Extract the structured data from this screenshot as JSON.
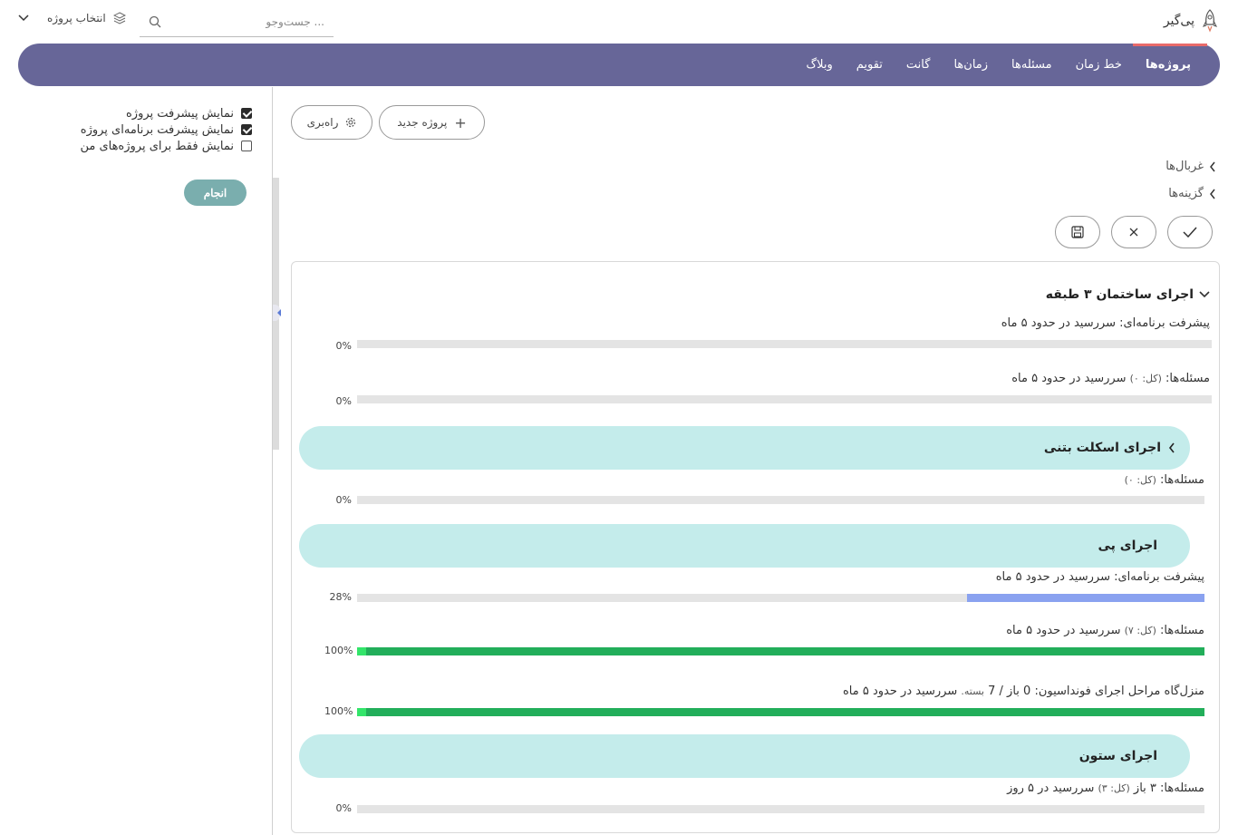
{
  "brand": {
    "name": "پی‌گیر"
  },
  "search": {
    "placeholder": "... جست‌وجو"
  },
  "project_select": {
    "label": "انتخاب پروژه"
  },
  "nav": {
    "items": [
      {
        "label": "پروژه‌ها",
        "active": true
      },
      {
        "label": "خط زمان"
      },
      {
        "label": "مسئله‌ها"
      },
      {
        "label": "زمان‌ها"
      },
      {
        "label": "گانت"
      },
      {
        "label": "تقویم"
      },
      {
        "label": "وبلاگ"
      }
    ],
    "background": "#676698",
    "active_indicator": "#e86a6a"
  },
  "sidebar": {
    "options": [
      {
        "label": "نمایش پیشرفت پروژه",
        "checked": true
      },
      {
        "label": "نمایش پیشرفت برنامه‌ای پروژه",
        "checked": true
      },
      {
        "label": "نمایش فقط برای پروژه‌های من",
        "checked": false
      }
    ],
    "apply_label": "انجام"
  },
  "toolbar": {
    "new_project": "پروژه جدید",
    "help": "راه‌بری"
  },
  "sections": {
    "filters": "غربال‌ها",
    "options": "گزینه‌ها"
  },
  "project": {
    "title": "اجرای ساختمان ۳ طبقه",
    "rows": [
      {
        "label": "پیشرفت برنامه‌ای: سررسید در حدود ۵ ماه",
        "percent_text": "0%",
        "value": 0
      },
      {
        "label": "مسئله‌ها:",
        "total": "(کل: ۰)",
        "suffix": "سررسید در حدود ۵ ماه",
        "percent_text": "0%",
        "value": 0
      }
    ],
    "groups": [
      {
        "title": "اجرای اسکلت بتنی",
        "rows": [
          {
            "label": "مسئله‌ها:",
            "total": "(کل: ۰)",
            "percent_text": "0%",
            "value": 0
          }
        ]
      },
      {
        "title": "اجرای پی",
        "rows": [
          {
            "label": "پیشرفت برنامه‌ای: سررسید در حدود ۵ ماه",
            "percent_text": "28%",
            "value": 28,
            "color": "#8aa2f0"
          },
          {
            "label": "مسئله‌ها:",
            "total": "(کل: ۷)",
            "suffix": "سررسید در حدود ۵ ماه",
            "percent_text": "100%",
            "value": 100,
            "color": "#22ae5a"
          },
          {
            "label": "منزل‌گاه مراحل اجرای فونداسیون: 0 باز / 7",
            "closed": "بسته.",
            "suffix": "سررسید در حدود ۵ ماه",
            "percent_text": "100%",
            "value": 100,
            "color": "#22ae5a"
          }
        ]
      },
      {
        "title": "اجرای ستون",
        "rows": [
          {
            "label": "مسئله‌ها: ۳ باز",
            "total": "(کل: ۳)",
            "suffix": "سررسید در ۵ روز",
            "percent_text": "0%",
            "value": 0
          }
        ]
      }
    ]
  }
}
